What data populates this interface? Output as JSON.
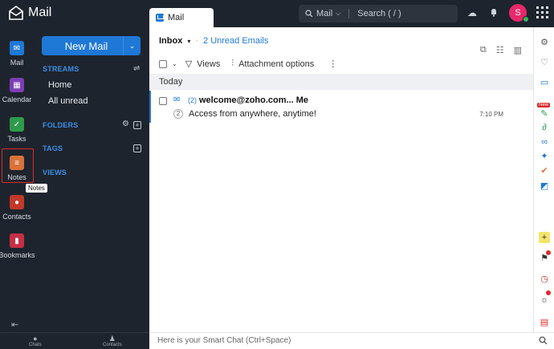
{
  "app": {
    "name": "Mail"
  },
  "tab": {
    "label": "Mail"
  },
  "search": {
    "scope": "Mail",
    "placeholder": "Search ( / )"
  },
  "user": {
    "initial": "S"
  },
  "rail": {
    "items": [
      {
        "label": "Mail",
        "icon": "mail-icon",
        "color": "#1e78d6"
      },
      {
        "label": "Calendar",
        "icon": "calendar-icon",
        "color": "#7b3fb5"
      },
      {
        "label": "Tasks",
        "icon": "check-icon",
        "color": "#2e9b4a"
      },
      {
        "label": "Notes",
        "icon": "note-icon",
        "color": "#d9733a"
      },
      {
        "label": "Contacts",
        "icon": "contact-icon",
        "color": "#c0392b"
      },
      {
        "label": "Bookmarks",
        "icon": "bookmark-icon",
        "color": "#c62f45"
      }
    ],
    "tooltip": "Notes"
  },
  "sidebar": {
    "new_mail": "New Mail",
    "streams": "STREAMS",
    "home": "Home",
    "all_unread": "All unread",
    "folders": "FOLDERS",
    "tags": "TAGS",
    "views": "VIEWS"
  },
  "main": {
    "folder": "Inbox",
    "unread": "2 Unread Emails",
    "toolbar": {
      "views": "Views",
      "attachment": "Attachment options"
    },
    "group": "Today",
    "emails": [
      {
        "count": "(2)",
        "sender": "welcome@zoho.com... Me",
        "thread": "2",
        "subject": "Access from anywhere, anytime!",
        "time": "7:10 PM"
      }
    ]
  },
  "right_strip": {
    "new_badge": "New"
  },
  "bottom": {
    "chats": "Chats",
    "contacts": "Contacts",
    "smart_chat": "Here is your Smart Chat (Ctrl+Space)"
  },
  "colors": {
    "accent": "#1e78d6",
    "sidebar_bg": "#1e242d",
    "avatar": "#e8286b"
  }
}
